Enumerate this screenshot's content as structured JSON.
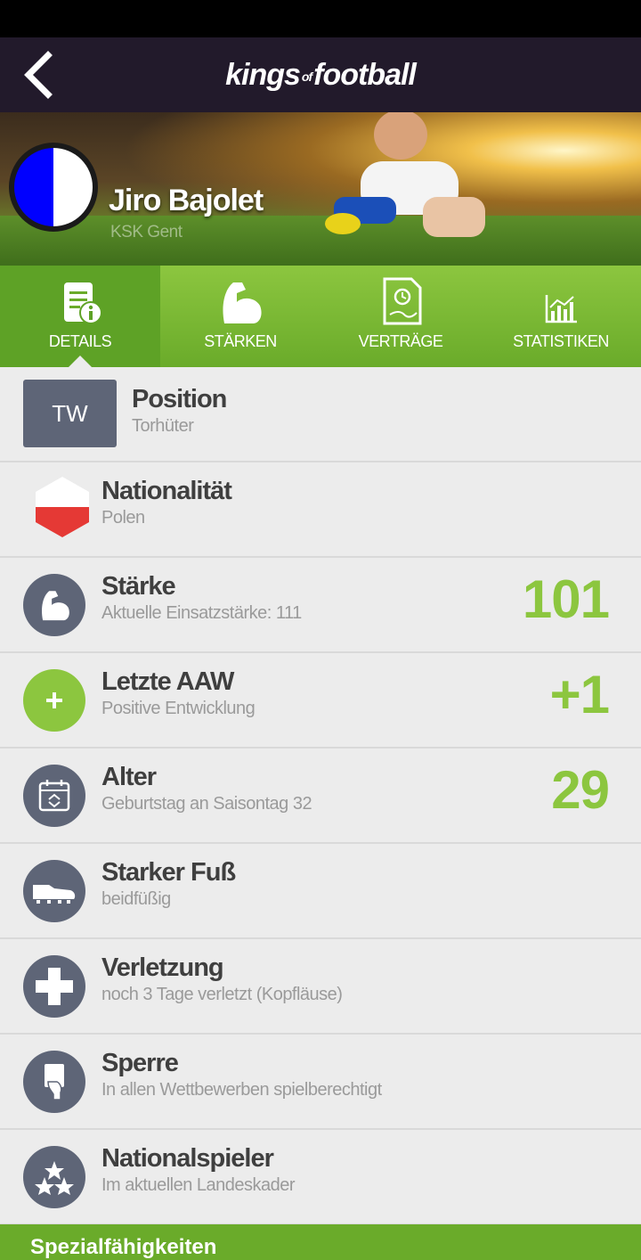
{
  "header": {
    "logo_kings": "kings",
    "logo_of": "of",
    "logo_football": "football"
  },
  "player": {
    "name": "Jiro Bajolet",
    "club": "KSK Gent",
    "crest_colors": [
      "#0000ff",
      "#ffffff"
    ]
  },
  "tabs": [
    {
      "label": "DETAILS",
      "icon": "document-info-icon",
      "active": true
    },
    {
      "label": "STÄRKEN",
      "icon": "flexed-arm-icon",
      "active": false
    },
    {
      "label": "VERTRÄGE",
      "icon": "contract-icon",
      "active": false
    },
    {
      "label": "STATISTIKEN",
      "icon": "chart-icon",
      "active": false
    }
  ],
  "rows": {
    "position": {
      "badge": "TW",
      "title": "Position",
      "sub": "Torhüter"
    },
    "nationality": {
      "title": "Nationalität",
      "sub": "Polen"
    },
    "strength": {
      "title": "Stärke",
      "sub": "Aktuelle Einsatzstärke: 111",
      "value": "101"
    },
    "aaw": {
      "title": "Letzte AAW",
      "sub": "Positive Entwicklung",
      "value": "+1"
    },
    "age": {
      "title": "Alter",
      "sub": "Geburtstag an Saisontag 32",
      "value": "29"
    },
    "foot": {
      "title": "Starker Fuß",
      "sub": "beidfüßig"
    },
    "injury": {
      "title": "Verletzung",
      "sub": "noch 3 Tage verletzt (Kopfläuse)"
    },
    "ban": {
      "title": "Sperre",
      "sub": "In allen Wettbewerben spielberechtigt"
    },
    "national": {
      "title": "Nationalspieler",
      "sub": "Im aktuellen Landeskader"
    }
  },
  "footer": {
    "label": "Spezialfähigkeiten"
  },
  "colors": {
    "accent": "#8cc63f",
    "icon_bg": "#5e6577",
    "topbar": "#221a2b"
  }
}
